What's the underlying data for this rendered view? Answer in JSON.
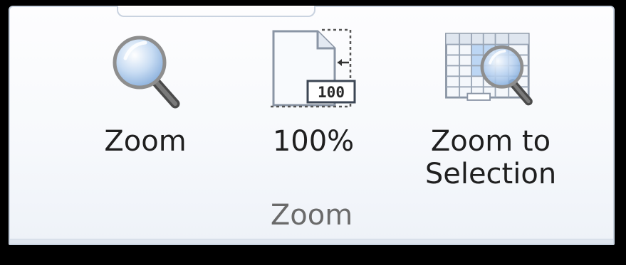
{
  "group": {
    "label": "Zoom"
  },
  "buttons": {
    "zoom": {
      "label": "Zoom",
      "icon": "magnifier-icon"
    },
    "hundred": {
      "label": "100%",
      "icon": "page-100-icon",
      "badge": "100"
    },
    "selection": {
      "label": "Zoom to\nSelection",
      "icon": "zoom-selection-icon"
    }
  },
  "colors": {
    "background": "#000000",
    "panel": "#f7f9fc",
    "border": "#c9d3e0",
    "text": "#1f1f1f",
    "group_label": "#6a6a6a",
    "lens": "#a9c8ec",
    "highlight": "#bcd6f4"
  }
}
